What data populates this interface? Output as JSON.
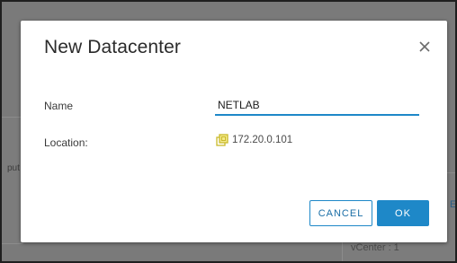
{
  "background": {
    "left_partial_text": "put",
    "right_partial_text": "vCenter : 1",
    "right_edge_text": "EN"
  },
  "dialog": {
    "title": "New Datacenter",
    "close_icon": "close-icon",
    "name_label": "Name",
    "name_value": "NETLAB",
    "location_label": "Location:",
    "location_icon": "vcenter-server-icon",
    "location_value": "172.20.0.101",
    "cancel_label": "CANCEL",
    "ok_label": "OK"
  },
  "colors": {
    "accent": "#1e88c8",
    "location_icon": "#c9b92a",
    "overlay": "#7a7a7a"
  }
}
